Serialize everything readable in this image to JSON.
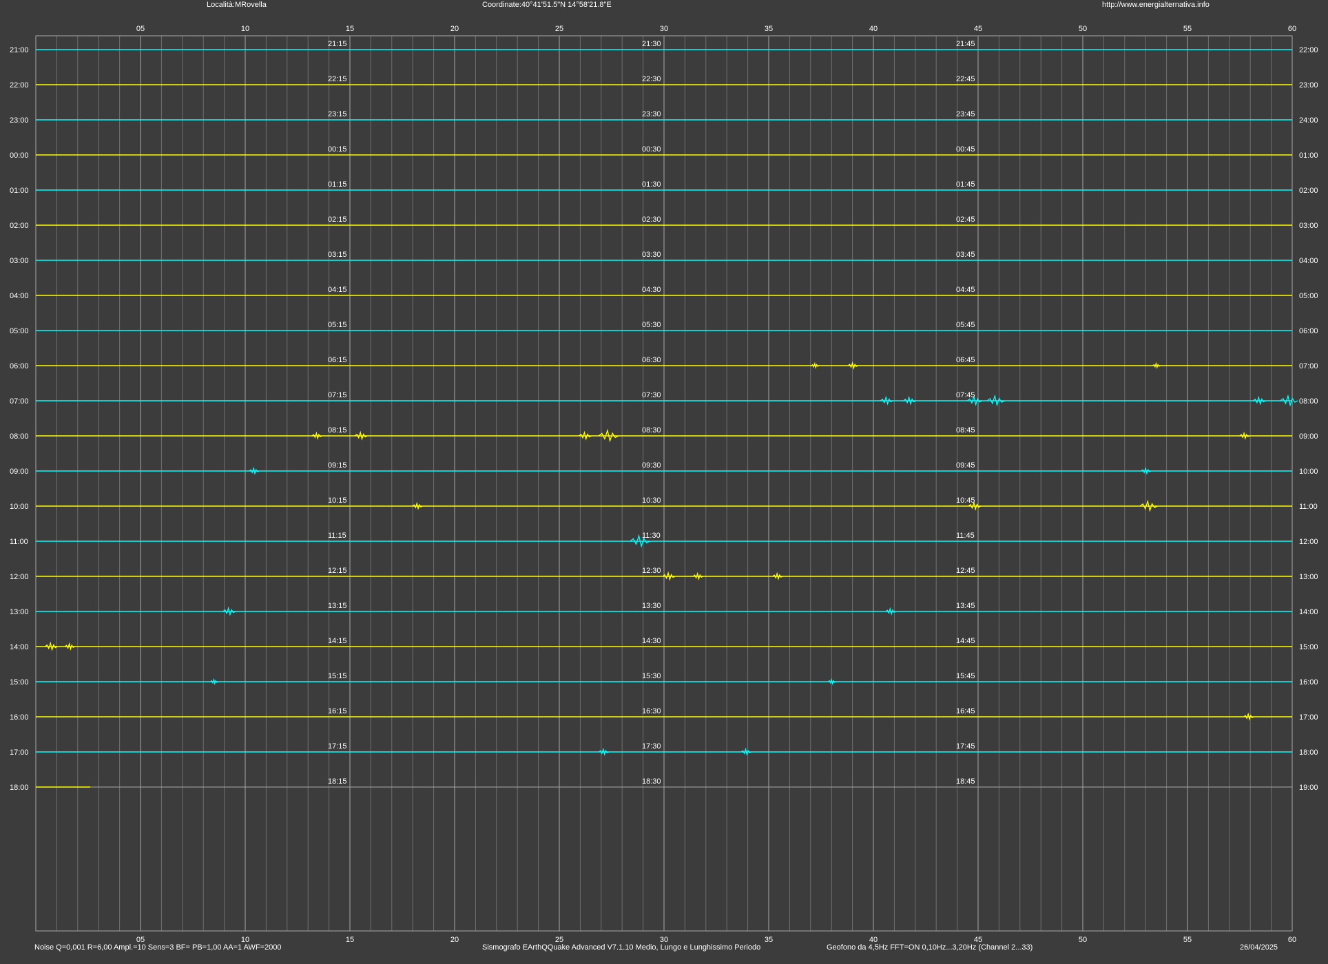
{
  "header": {
    "location": "Località:MRovella",
    "coordinates": "Coordinate:40°41'51.5\"N 14°58'21.8\"E",
    "website": "http://www.energialternativa.info"
  },
  "footer": {
    "settings": "Noise Q=0,001 R=6,00 Ampl.=10 Sens=3 BF= PB=1,00 AA=1 AWF=2000",
    "software": "Sismografo  EArthQQuake Advanced V7.1.10  Medio, Lungo e Lunghissimo Periodo",
    "sensor": "Geofono da 4,5Hz FFT=ON 0,10Hz...3,20Hz      (Channel 2...33)",
    "date": "26/04/2025"
  },
  "colors": {
    "background": "#3c3c3c",
    "grid_major": "#a8a8a8",
    "grid_minor": "#707070",
    "trace_a": "#00ffff",
    "trace_b": "#ffff00",
    "text": "#ffffff"
  },
  "chart_data": {
    "type": "line",
    "xlabel": "",
    "ylabel": "",
    "xlim": [
      0,
      60
    ],
    "x_ticks": [
      "05",
      "10",
      "15",
      "20",
      "25",
      "30",
      "35",
      "40",
      "45",
      "50",
      "55",
      "60"
    ],
    "minor_grid_step_minutes": 1,
    "grid": true,
    "rows": [
      {
        "left": "21:00",
        "right": "22:00",
        "q": [
          "21:15",
          "21:30",
          "21:45"
        ],
        "color": "cyan",
        "end_minute": 60
      },
      {
        "left": "22:00",
        "right": "23:00",
        "q": [
          "22:15",
          "22:30",
          "22:45"
        ],
        "color": "yellow",
        "end_minute": 60
      },
      {
        "left": "23:00",
        "right": "24:00",
        "q": [
          "23:15",
          "23:30",
          "23:45"
        ],
        "color": "cyan",
        "end_minute": 60
      },
      {
        "left": "00:00",
        "right": "01:00",
        "q": [
          "00:15",
          "00:30",
          "00:45"
        ],
        "color": "yellow",
        "end_minute": 60
      },
      {
        "left": "01:00",
        "right": "02:00",
        "q": [
          "01:15",
          "01:30",
          "01:45"
        ],
        "color": "cyan",
        "end_minute": 60
      },
      {
        "left": "02:00",
        "right": "03:00",
        "q": [
          "02:15",
          "02:30",
          "02:45"
        ],
        "color": "yellow",
        "end_minute": 60
      },
      {
        "left": "03:00",
        "right": "04:00",
        "q": [
          "03:15",
          "03:30",
          "03:45"
        ],
        "color": "cyan",
        "end_minute": 60
      },
      {
        "left": "04:00",
        "right": "05:00",
        "q": [
          "04:15",
          "04:30",
          "04:45"
        ],
        "color": "yellow",
        "end_minute": 60
      },
      {
        "left": "05:00",
        "right": "06:00",
        "q": [
          "05:15",
          "05:30",
          "05:45"
        ],
        "color": "cyan",
        "end_minute": 60
      },
      {
        "left": "06:00",
        "right": "07:00",
        "q": [
          "06:15",
          "06:30",
          "06:45"
        ],
        "color": "yellow",
        "end_minute": 60
      },
      {
        "left": "07:00",
        "right": "08:00",
        "q": [
          "07:15",
          "07:30",
          "07:45"
        ],
        "color": "cyan",
        "end_minute": 60
      },
      {
        "left": "08:00",
        "right": "09:00",
        "q": [
          "08:15",
          "08:30",
          "08:45"
        ],
        "color": "yellow",
        "end_minute": 60
      },
      {
        "left": "09:00",
        "right": "10:00",
        "q": [
          "09:15",
          "09:30",
          "09:45"
        ],
        "color": "cyan",
        "end_minute": 60
      },
      {
        "left": "10:00",
        "right": "11:00",
        "q": [
          "10:15",
          "10:30",
          "10:45"
        ],
        "color": "yellow",
        "end_minute": 60
      },
      {
        "left": "11:00",
        "right": "12:00",
        "q": [
          "11:15",
          "11:30",
          "11:45"
        ],
        "color": "cyan",
        "end_minute": 60
      },
      {
        "left": "12:00",
        "right": "13:00",
        "q": [
          "12:15",
          "12:30",
          "12:45"
        ],
        "color": "yellow",
        "end_minute": 60
      },
      {
        "left": "13:00",
        "right": "14:00",
        "q": [
          "13:15",
          "13:30",
          "13:45"
        ],
        "color": "cyan",
        "end_minute": 60
      },
      {
        "left": "14:00",
        "right": "15:00",
        "q": [
          "14:15",
          "14:30",
          "14:45"
        ],
        "color": "yellow",
        "end_minute": 60
      },
      {
        "left": "15:00",
        "right": "16:00",
        "q": [
          "15:15",
          "15:30",
          "15:45"
        ],
        "color": "cyan",
        "end_minute": 60
      },
      {
        "left": "16:00",
        "right": "17:00",
        "q": [
          "16:15",
          "16:30",
          "16:45"
        ],
        "color": "yellow",
        "end_minute": 60
      },
      {
        "left": "17:00",
        "right": "18:00",
        "q": [
          "17:15",
          "17:30",
          "17:45"
        ],
        "color": "cyan",
        "end_minute": 60
      },
      {
        "left": "18:00",
        "right": "19:00",
        "q": [
          "18:15",
          "18:30",
          "18:45"
        ],
        "color": "yellow",
        "end_minute": 2.6
      }
    ],
    "events": [
      {
        "row": "06:00",
        "minute": 37.2,
        "amp": 3
      },
      {
        "row": "06:00",
        "minute": 39.0,
        "amp": 4
      },
      {
        "row": "06:00",
        "minute": 53.5,
        "amp": 3
      },
      {
        "row": "07:00",
        "minute": 40.6,
        "amp": 5
      },
      {
        "row": "07:00",
        "minute": 41.7,
        "amp": 5
      },
      {
        "row": "07:00",
        "minute": 44.8,
        "amp": 6
      },
      {
        "row": "07:00",
        "minute": 45.8,
        "amp": 7
      },
      {
        "row": "07:00",
        "minute": 58.4,
        "amp": 5
      },
      {
        "row": "07:00",
        "minute": 59.8,
        "amp": 7
      },
      {
        "row": "08:00",
        "minute": 13.4,
        "amp": 4
      },
      {
        "row": "08:00",
        "minute": 15.5,
        "amp": 5
      },
      {
        "row": "08:00",
        "minute": 26.2,
        "amp": 5
      },
      {
        "row": "08:00",
        "minute": 27.3,
        "amp": 8
      },
      {
        "row": "08:00",
        "minute": 57.7,
        "amp": 4
      },
      {
        "row": "09:00",
        "minute": 10.4,
        "amp": 4
      },
      {
        "row": "09:00",
        "minute": 53.0,
        "amp": 4
      },
      {
        "row": "10:00",
        "minute": 18.2,
        "amp": 4
      },
      {
        "row": "10:00",
        "minute": 44.8,
        "amp": 5
      },
      {
        "row": "10:00",
        "minute": 53.1,
        "amp": 7
      },
      {
        "row": "11:00",
        "minute": 28.8,
        "amp": 8
      },
      {
        "row": "12:00",
        "minute": 30.2,
        "amp": 5
      },
      {
        "row": "12:00",
        "minute": 31.6,
        "amp": 4
      },
      {
        "row": "12:00",
        "minute": 35.4,
        "amp": 4
      },
      {
        "row": "13:00",
        "minute": 9.2,
        "amp": 5
      },
      {
        "row": "13:00",
        "minute": 40.8,
        "amp": 4
      },
      {
        "row": "14:00",
        "minute": 0.7,
        "amp": 5
      },
      {
        "row": "14:00",
        "minute": 1.6,
        "amp": 4
      },
      {
        "row": "15:00",
        "minute": 8.5,
        "amp": 3
      },
      {
        "row": "15:00",
        "minute": 38.0,
        "amp": 3
      },
      {
        "row": "16:00",
        "minute": 57.9,
        "amp": 4
      },
      {
        "row": "17:00",
        "minute": 27.1,
        "amp": 4
      },
      {
        "row": "17:00",
        "minute": 33.9,
        "amp": 4
      }
    ]
  }
}
